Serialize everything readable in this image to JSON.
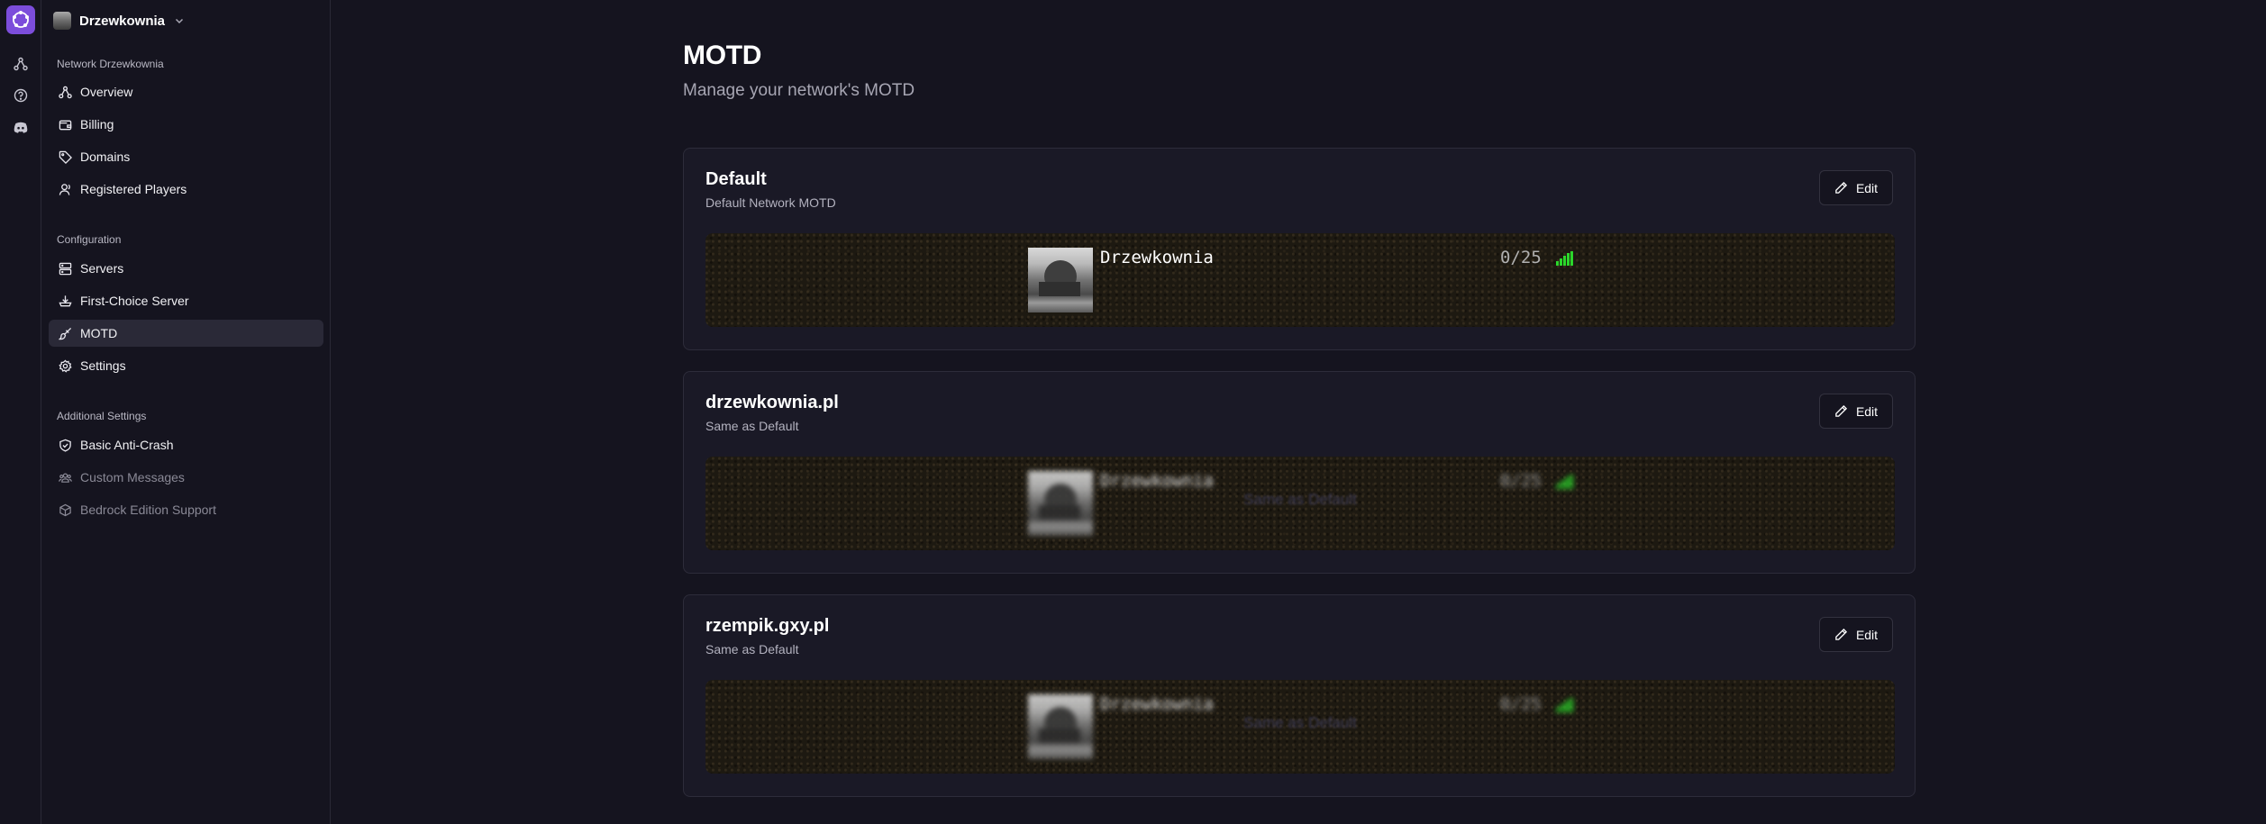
{
  "workspace": {
    "name": "Drzewkownia"
  },
  "sidebar": {
    "sections": [
      {
        "label": "Network Drzewkownia",
        "items": [
          {
            "label": "Overview",
            "icon": "network-icon"
          },
          {
            "label": "Billing",
            "icon": "wallet-icon"
          },
          {
            "label": "Domains",
            "icon": "tag-icon"
          },
          {
            "label": "Registered Players",
            "icon": "user-icon"
          }
        ]
      },
      {
        "label": "Configuration",
        "items": [
          {
            "label": "Servers",
            "icon": "server-icon"
          },
          {
            "label": "First-Choice Server",
            "icon": "download-tray-icon"
          },
          {
            "label": "MOTD",
            "icon": "brush-icon",
            "active": true
          },
          {
            "label": "Settings",
            "icon": "gear-icon"
          }
        ]
      },
      {
        "label": "Additional Settings",
        "items": [
          {
            "label": "Basic Anti-Crash",
            "icon": "shield-icon"
          },
          {
            "label": "Custom Messages",
            "icon": "users-icon",
            "disabled": true
          },
          {
            "label": "Bedrock Edition Support",
            "icon": "cube-icon",
            "disabled": true
          }
        ]
      }
    ]
  },
  "page": {
    "title": "MOTD",
    "subtitle": "Manage your network's MOTD"
  },
  "cards": [
    {
      "title": "Default",
      "subtitle": "Default Network MOTD",
      "edit_label": "Edit",
      "preview": {
        "server_name": "Drzewkownia",
        "players": "0/25",
        "blurred": false,
        "overlay": ""
      }
    },
    {
      "title": "drzewkownia.pl",
      "subtitle": "Same as Default",
      "edit_label": "Edit",
      "preview": {
        "server_name": "Drzewkownia",
        "players": "0/25",
        "blurred": true,
        "overlay": "Same as Default"
      }
    },
    {
      "title": "rzempik.gxy.pl",
      "subtitle": "Same as Default",
      "edit_label": "Edit",
      "preview": {
        "server_name": "Drzewkownia",
        "players": "0/25",
        "blurred": true,
        "overlay": "Same as Default"
      }
    }
  ],
  "colors": {
    "background": "#15141f",
    "card": "#1a1926",
    "accent": "#7c4ddb",
    "signal": "#2bd62b"
  }
}
